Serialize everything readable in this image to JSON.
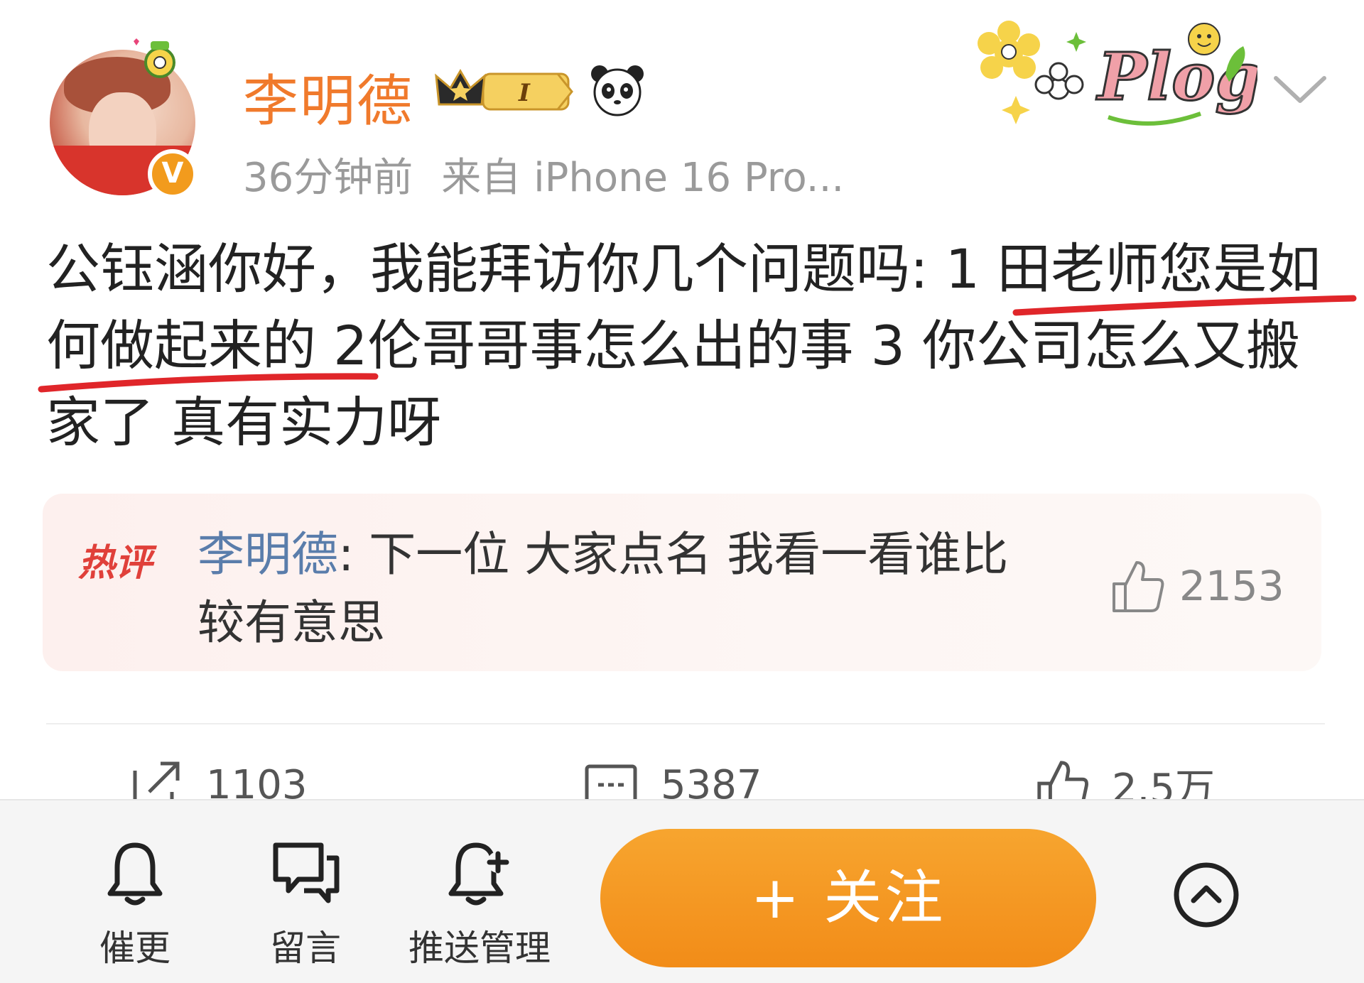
{
  "header": {
    "username": "李明德",
    "timestamp": "36分钟前",
    "source": "来自 iPhone 16 Pro...",
    "level_badge": "I",
    "verified_mark": "V",
    "sticker_text": "Plog"
  },
  "post": {
    "text": "公钰涵你好，我能拜访你几个问题吗: 1 田老师您是如何做起来的 2伦哥哥事怎么出的事 3 你公司怎么又搬家了 真有实力呀"
  },
  "hot_comment": {
    "label": "热评",
    "author": "李明德",
    "separator": ":",
    "text": "下一位 大家点名 我看一看谁比较有意思",
    "likes": "2153"
  },
  "actions": {
    "repost_count": "1103",
    "comment_count": "5387",
    "like_count": "2.5万"
  },
  "bottom_bar": {
    "remind_label": "催更",
    "message_label": "留言",
    "push_label": "推送管理",
    "follow_label": "+ 关注"
  },
  "colors": {
    "username": "#f07a2c",
    "follow_button": "#f28c18",
    "hot_label": "#e0403a",
    "commenter": "#5a7dab",
    "underline": "#e0262a"
  },
  "icons": {
    "verified": "verified-v-icon",
    "crown": "crown-icon",
    "panda": "panda-icon",
    "more": "chevron-down-icon",
    "like": "thumbs-up-icon",
    "repost": "repost-icon",
    "comment": "comment-icon",
    "bell": "bell-icon",
    "chat": "chat-bubble-icon",
    "bell_plus": "bell-plus-icon",
    "collapse": "chevron-up-circle-icon"
  }
}
